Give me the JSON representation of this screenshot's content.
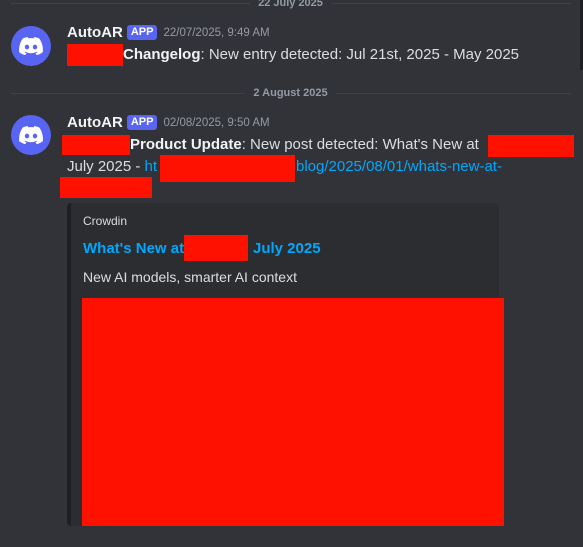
{
  "dividers": [
    "22 July 2025",
    "2 August 2025"
  ],
  "messages": [
    {
      "author": "AutoAR",
      "badge": "APP",
      "timestamp": "22/07/2025, 9:49 AM",
      "title": "Changelog",
      "text": ": New entry detected: Jul 21st, 2025 - May 2025"
    },
    {
      "author": "AutoAR",
      "badge": "APP",
      "timestamp": "02/08/2025, 9:50 AM",
      "title": "Product Update",
      "text_start": ": New post detected: What's New at",
      "text_line2": "July 2025 - ",
      "link_start": "ht",
      "link_end": "blog/2025/08/01/whats-new-at-",
      "embed": {
        "provider": "Crowdin",
        "title_start": "What's New at",
        "title_end": "July 2025",
        "description": "New AI models, smarter AI context"
      }
    }
  ],
  "colors": {
    "background": "#313338",
    "accent": "#5865f2",
    "link": "#00a8fc",
    "redaction": "#ff1100"
  },
  "icons": {
    "avatar": "discord-logo-icon"
  }
}
